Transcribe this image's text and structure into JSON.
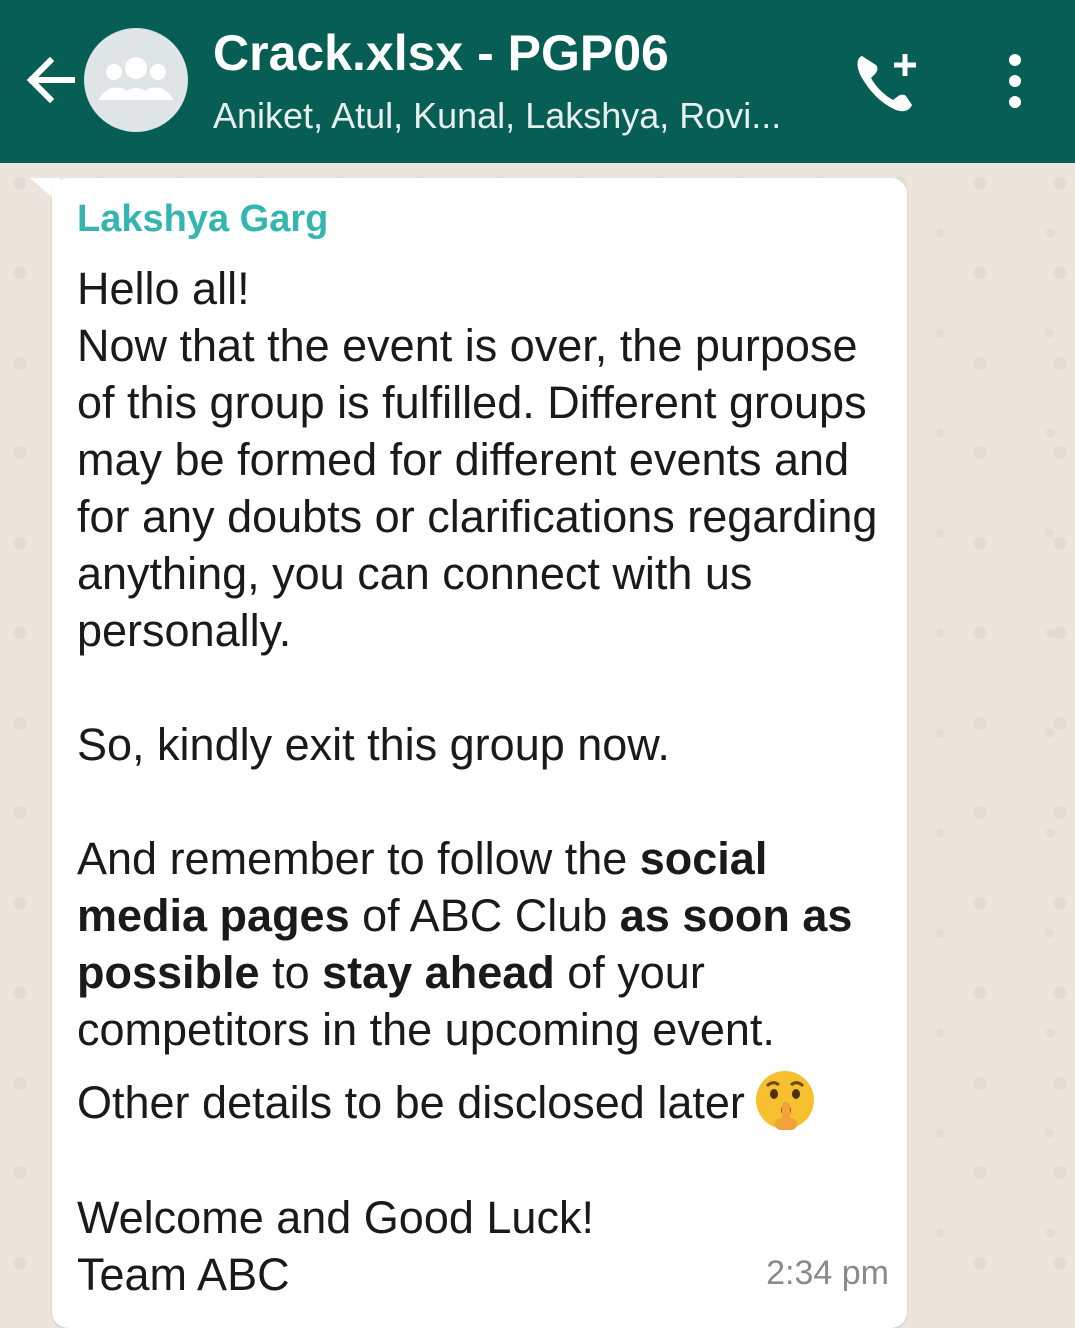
{
  "header": {
    "title": "Crack.xlsx - PGP06",
    "subtitle": "Aniket, Atul, Kunal, Lakshya, Rovi...",
    "colors": {
      "bar": "#075e54",
      "sender": "#35b5b0"
    }
  },
  "message": {
    "sender": "Lakshya Garg",
    "line1": "Hello all!",
    "para1": "Now that the event is over, the purpose of this group is fulfilled. Different groups may be formed for different events and for any doubts or clarifications regarding anything, you can connect with us personally.",
    "para2": "So, kindly exit this group now.",
    "para3": {
      "a": "And remember to follow the ",
      "b": "social media pages",
      "c": " of ABC Club ",
      "d": "as soon as possible",
      "e": " to ",
      "f": "stay ahead",
      "g": " of your competitors in the upcoming event."
    },
    "para4": "Other details to be disclosed later",
    "emoji": "shushing-face",
    "closing1": "Welcome and Good Luck!",
    "closing2": "Team ABC",
    "time": "2:34 pm"
  }
}
